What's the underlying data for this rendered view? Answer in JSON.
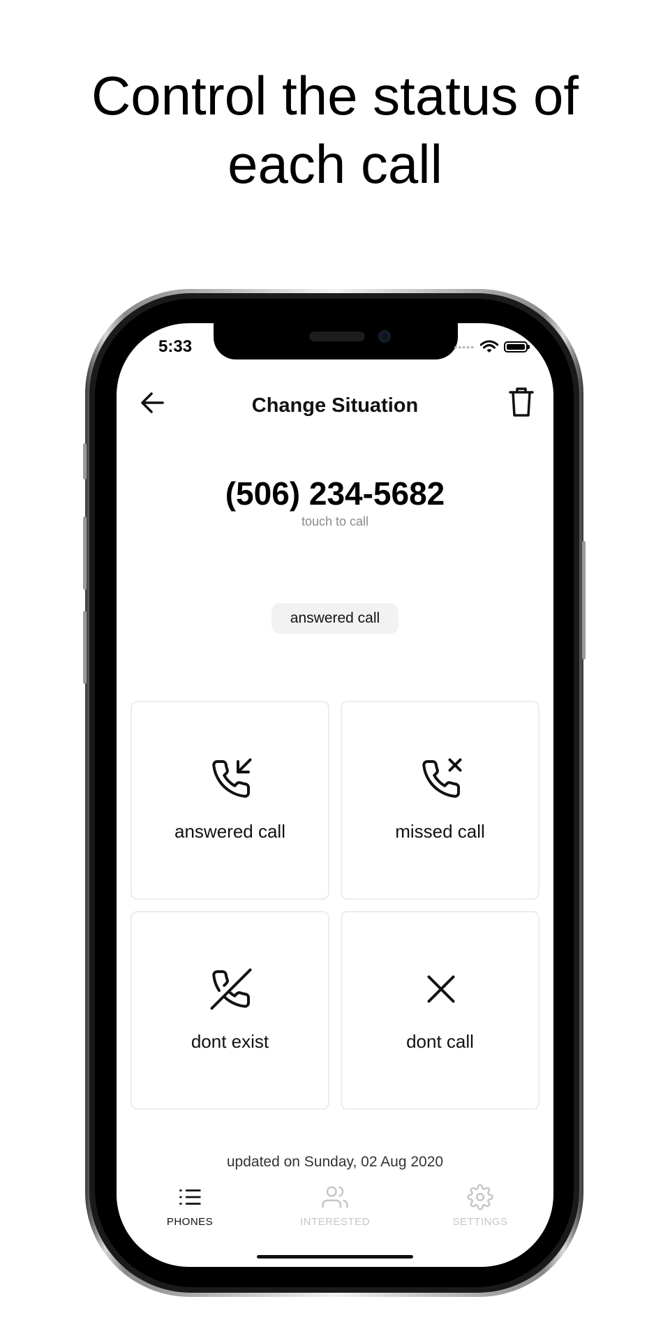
{
  "headline": {
    "line1": "Control the status of",
    "line2": "each call"
  },
  "status_bar": {
    "time": "5:33",
    "signal": "•••••"
  },
  "nav": {
    "title": "Change Situation",
    "back_icon": "arrow-left-icon",
    "delete_icon": "trash-icon"
  },
  "contact": {
    "number": "(506) 234-5682",
    "hint": "touch to call"
  },
  "current_status": "answered call",
  "options": [
    {
      "label": "answered call",
      "icon": "phone-incoming-icon"
    },
    {
      "label": "missed call",
      "icon": "phone-missed-icon"
    },
    {
      "label": "dont exist",
      "icon": "phone-off-icon"
    },
    {
      "label": "dont call",
      "icon": "x-icon"
    }
  ],
  "updated": "updated on Sunday, 02 Aug 2020",
  "tabs": [
    {
      "label": "PHONES",
      "icon": "list-icon",
      "active": true
    },
    {
      "label": "INTERESTED",
      "icon": "users-icon",
      "active": false
    },
    {
      "label": "SETTINGS",
      "icon": "gear-icon",
      "active": false
    }
  ],
  "colors": {
    "active_tab": "#111111",
    "inactive_tab": "#c6c6c6",
    "chip_bg": "#f2f2f2",
    "card_border": "#ececec"
  }
}
